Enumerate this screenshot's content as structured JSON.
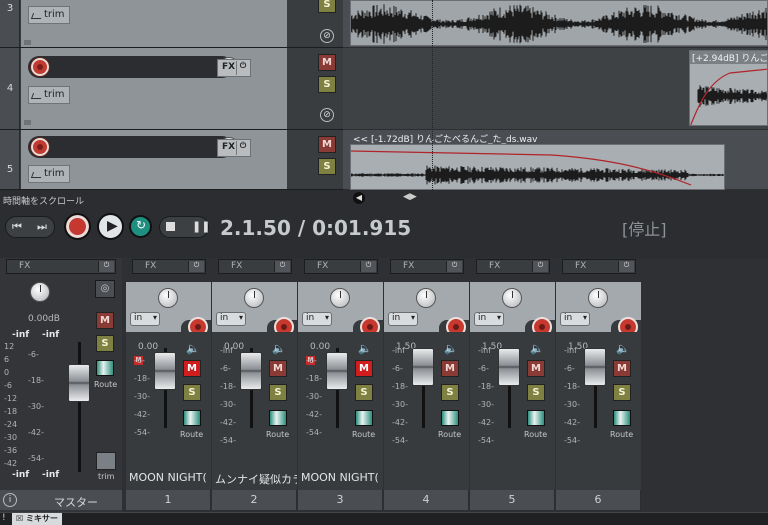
{
  "tracks": [
    {
      "number": "3",
      "trim_label": "trim"
    },
    {
      "number": "4",
      "fx_label": "FX",
      "trim_label": "trim",
      "mute": "M",
      "solo": "S"
    },
    {
      "number": "5",
      "fx_label": "FX",
      "trim_label": "trim",
      "mute": "M",
      "solo": "S"
    }
  ],
  "solo_top": "S",
  "items": {
    "track4_label": "[+2.94dB] りんご",
    "track5_label": "<< [-1.72dB] りんごたべるんご_た_ds.wav"
  },
  "transport": {
    "scroll_hint": "時間軸をスクロール",
    "position": "2.1.50 / 0:01.915",
    "state": "[停止]"
  },
  "mixer": {
    "master": {
      "fx_label": "FX",
      "db": "0.00dB",
      "peak_l": "-inf",
      "peak_r": "-inf",
      "bottom_l": "-inf",
      "bottom_r": "-inf",
      "mute": "M",
      "solo": "S",
      "route": "Route",
      "trim": "trim",
      "label": "マスター",
      "scale": [
        "12",
        "6",
        "0",
        "-6",
        "-12",
        "-18",
        "-24",
        "-30",
        "-36",
        "-42"
      ],
      "scale_mid": [
        "-6-",
        "-18-",
        "-30-",
        "-42-",
        "-54-"
      ]
    },
    "strips": [
      {
        "num": "1",
        "name": "MOON NIGHT(",
        "db": "0.00",
        "in": "in",
        "fx_label": "FX",
        "mute": "M",
        "solo": "S",
        "route": "Route",
        "muted": true,
        "mmark": "M",
        "scale": [
          "-6-",
          "-18-",
          "-30-",
          "-42-",
          "-54-"
        ]
      },
      {
        "num": "2",
        "name": "ムンナイ疑似カラ",
        "db": "0.00",
        "in": "in",
        "fx_label": "FX",
        "mute": "M",
        "solo": "S",
        "route": "Route",
        "muted": false,
        "mmark": "",
        "scale": [
          "-inf",
          "-6-",
          "-18-",
          "-30-",
          "-42-",
          "-54-"
        ]
      },
      {
        "num": "3",
        "name": "MOON NIGHT(",
        "db": "0.00",
        "in": "in",
        "fx_label": "FX",
        "mute": "M",
        "solo": "S",
        "route": "Route",
        "muted": true,
        "mmark": "M",
        "scale": [
          "-6-",
          "-18-",
          "-30-",
          "-42-",
          "-54-"
        ]
      },
      {
        "num": "4",
        "name": "",
        "db": "1.50",
        "in": "in",
        "fx_label": "FX",
        "mute": "M",
        "solo": "S",
        "route": "Route",
        "muted": false,
        "mmark": "",
        "scale": [
          "-inf",
          "-6-",
          "-18-",
          "-30-",
          "-42-",
          "-54-"
        ]
      },
      {
        "num": "5",
        "name": "",
        "db": "1.50",
        "in": "in",
        "fx_label": "FX",
        "mute": "M",
        "solo": "S",
        "route": "Route",
        "muted": false,
        "mmark": "",
        "scale": [
          "-inf",
          "-6-",
          "-18-",
          "-30-",
          "-42-",
          "-54-"
        ]
      },
      {
        "num": "6",
        "name": "",
        "db": "1.50",
        "in": "in",
        "fx_label": "FX",
        "mute": "M",
        "solo": "S",
        "route": "Route",
        "muted": false,
        "mmark": "",
        "scale": [
          "-inf",
          "-6-",
          "-18-",
          "-30-",
          "-42-",
          "-54-"
        ]
      }
    ]
  },
  "bottom_tab": "ミキサー",
  "colors": {
    "record": "#c23b32",
    "mute_on": "#d01e1e",
    "solo": "#7f8143"
  }
}
